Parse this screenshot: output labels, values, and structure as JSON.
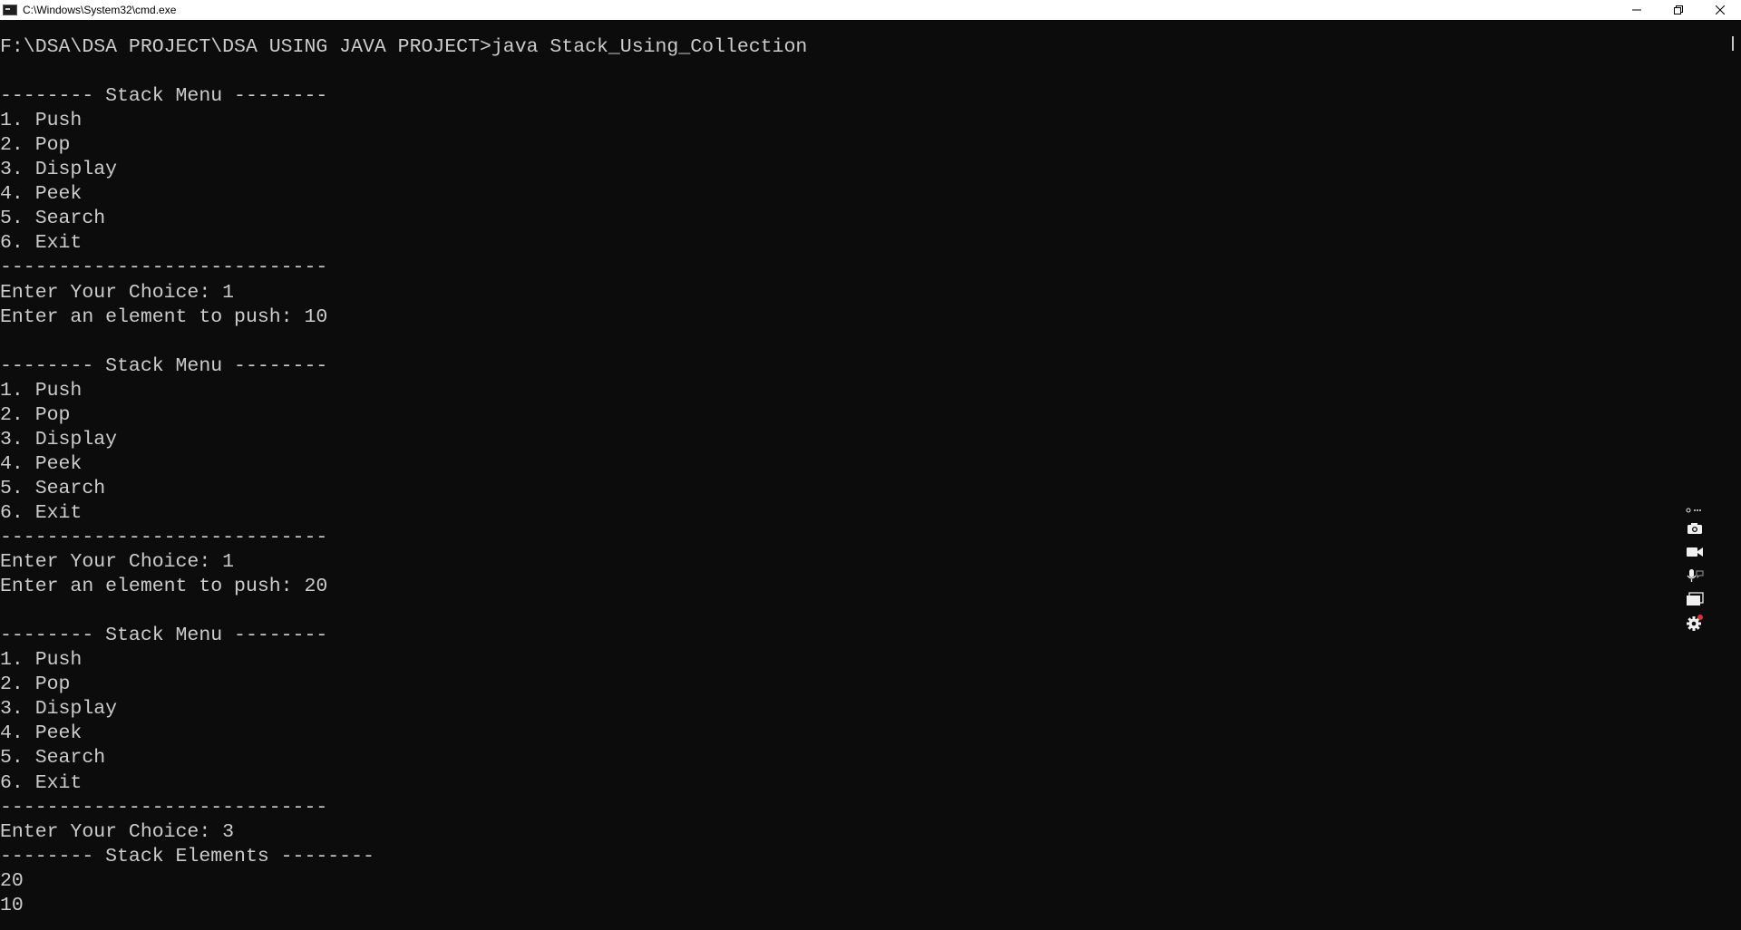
{
  "window": {
    "title": "C:\\Windows\\System32\\cmd.exe",
    "icon": "cmd-icon",
    "controls": {
      "minimize_icon": "minimize-icon",
      "restore_icon": "restore-icon",
      "close_icon": "close-icon"
    }
  },
  "console": {
    "lines": [
      "F:\\DSA\\DSA PROJECT\\DSA USING JAVA PROJECT>java Stack_Using_Collection",
      "",
      "-------- Stack Menu --------",
      "1. Push",
      "2. Pop",
      "3. Display",
      "4. Peek",
      "5. Search",
      "6. Exit",
      "----------------------------",
      "Enter Your Choice: 1",
      "Enter an element to push: 10",
      "",
      "-------- Stack Menu --------",
      "1. Push",
      "2. Pop",
      "3. Display",
      "4. Peek",
      "5. Search",
      "6. Exit",
      "----------------------------",
      "Enter Your Choice: 1",
      "Enter an element to push: 20",
      "",
      "-------- Stack Menu --------",
      "1. Push",
      "2. Pop",
      "3. Display",
      "4. Peek",
      "5. Search",
      "6. Exit",
      "----------------------------",
      "Enter Your Choice: 3",
      "-------- Stack Elements --------",
      "20",
      "10"
    ]
  },
  "floating_toolbar": {
    "items": [
      "more-icon",
      "camera-icon",
      "video-icon",
      "mic-icon",
      "window-icon",
      "settings-icon"
    ]
  },
  "colors": {
    "background": "#0c0c0c",
    "text": "#cccccc",
    "titlebar": "#ffffff"
  }
}
